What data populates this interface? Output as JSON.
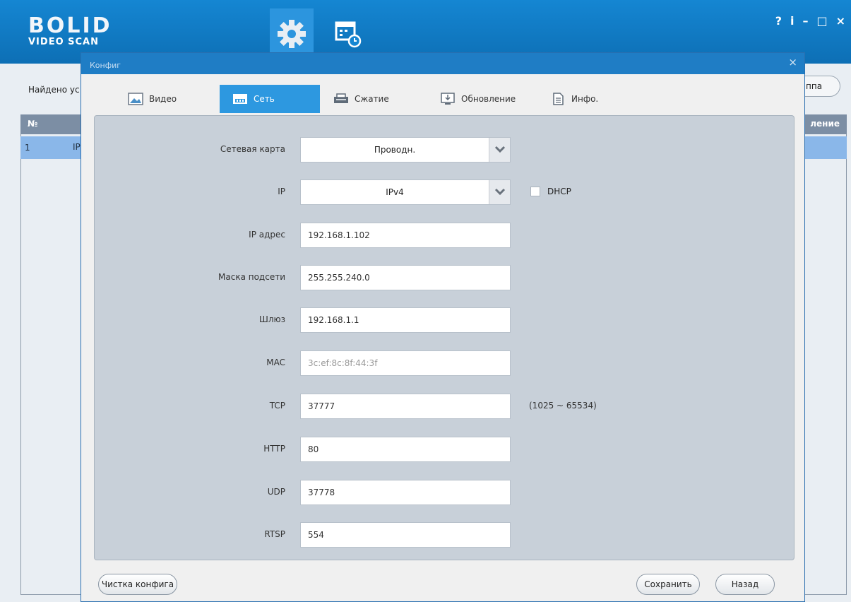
{
  "app": {
    "logo_line1": "BOLID",
    "logo_line2": "VIDEO SCAN",
    "window_controls": [
      "?",
      "i",
      "–",
      "□",
      "×"
    ],
    "found_label": "Найдено ус",
    "right_pill_label": "ппа",
    "grid": {
      "header_first": "№",
      "header_last": "ление",
      "row": {
        "num": "1",
        "partial": "IP"
      }
    }
  },
  "dialog": {
    "title": "Конфиг",
    "close": "×",
    "tabs": [
      {
        "label": "Видео",
        "icon": "image-icon"
      },
      {
        "label": "Сеть",
        "icon": "network-icon",
        "active": true
      },
      {
        "label": "Сжатие",
        "icon": "compress-icon"
      },
      {
        "label": "Обновление",
        "icon": "update-icon"
      },
      {
        "label": "Инфо.",
        "icon": "document-icon"
      }
    ],
    "form": {
      "network_card": {
        "label": "Сетевая карта",
        "value": "Проводн."
      },
      "ip_version": {
        "label": "IP",
        "value": "IPv4"
      },
      "dhcp": {
        "label": "DHCP",
        "checked": false
      },
      "ip_address": {
        "label": "IP адрес",
        "value": "192.168.1.102"
      },
      "subnet_mask": {
        "label": "Маска подсети",
        "value": "255.255.240.0"
      },
      "gateway": {
        "label": "Шлюз",
        "value": "192.168.1.1"
      },
      "mac": {
        "label": "MAC",
        "value": "3c:ef:8c:8f:44:3f"
      },
      "tcp": {
        "label": "TCP",
        "value": "37777",
        "hint": "(1025 ~ 65534)"
      },
      "http": {
        "label": "HTTP",
        "value": "80"
      },
      "udp": {
        "label": "UDP",
        "value": "37778"
      },
      "rtsp": {
        "label": "RTSP",
        "value": "554"
      }
    },
    "buttons": {
      "clear_config": "Чистка конфига",
      "save": "Сохранить",
      "back": "Назад"
    }
  },
  "colors": {
    "topbar": "#1586d2",
    "active_tab": "#2d98e0",
    "dialog_title": "#1f7dc5",
    "panel": "#c8d0d9"
  }
}
